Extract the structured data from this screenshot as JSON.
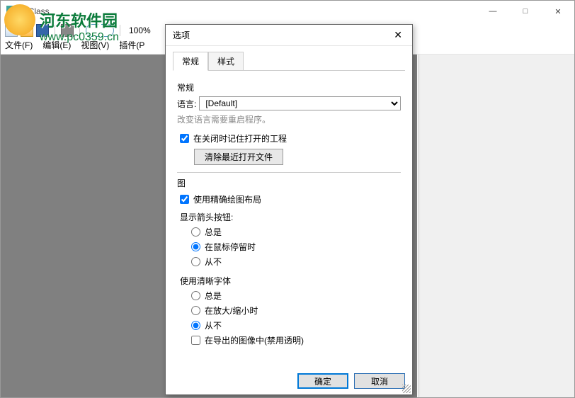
{
  "window": {
    "title": "NClass",
    "min": "—",
    "max": "□",
    "close": "✕"
  },
  "toolbar": {
    "zoom": "100%"
  },
  "menubar": {
    "file": "文件(F)",
    "edit": "编辑(E)",
    "view": "视图(V)",
    "plugin": "插件(P"
  },
  "watermark": {
    "site": "河东软件园",
    "url": "www.pc0359.cn"
  },
  "dialog": {
    "title": "选项",
    "close": "✕",
    "tabs": {
      "general": "常规",
      "style": "样式"
    },
    "section_general": "常规",
    "lang_label": "语言:",
    "lang_value": "[Default]",
    "lang_hint": "改变语言需要重启程序。",
    "cb_remember": "在关闭时记住打开的工程",
    "btn_clear": "清除最近打开文件",
    "section_diagram": "图",
    "cb_precise": "使用精确绘图布局",
    "arrow_title": "显示箭头按钮:",
    "arrow_always": "总是",
    "arrow_hover": "在鼠标停留时",
    "arrow_never": "从不",
    "font_title": "使用清晰字体",
    "font_always": "总是",
    "font_zoom": "在放大/缩小时",
    "font_never": "从不",
    "cb_disable_trans": "在导出的图像中(禁用透明)",
    "ok": "确定",
    "cancel": "取消"
  }
}
